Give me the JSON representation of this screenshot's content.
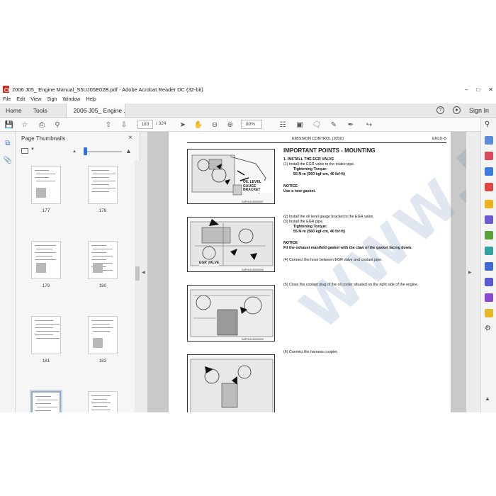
{
  "window": {
    "title": "2006 J05_ Engine Manual_S5UJ05E02B.pdf - Adobe Acrobat Reader DC (32-bit)"
  },
  "menu": [
    "File",
    "Edit",
    "View",
    "Sign",
    "Window",
    "Help"
  ],
  "tabs": {
    "home": "Home",
    "tools": "Tools",
    "document": "2006 J05_ Engine ...",
    "close": "×",
    "sign_in": "Sign In"
  },
  "toolbar": {
    "current_page": "183",
    "total_pages": "/ 324",
    "zoom": "80%"
  },
  "panel": {
    "title": "Page Thumbnails",
    "close": "×",
    "thumbnails": [
      {
        "label": "177"
      },
      {
        "label": "178"
      },
      {
        "label": "179"
      },
      {
        "label": "180"
      },
      {
        "label": "181"
      },
      {
        "label": "182"
      },
      {
        "label": "183",
        "selected": true
      },
      {
        "label": "184"
      },
      {
        "label": ""
      },
      {
        "label": ""
      }
    ]
  },
  "document": {
    "header_title": "EMISSION CONTROL (J05D)",
    "header_page": "EN10–5",
    "section_title": "IMPORTANT POINTS - MOUNTING",
    "step1_heading": "1.    INSTALL THE EGR VALVE",
    "step1_1": "(1)    Install the EGR valve to the intake pipe.",
    "torque_label": "Tightening Torque:",
    "torque_value": "55 N·m {560 kgf·cm, 40 lbf·ft}",
    "notice": "NOTICE",
    "notice1_text": "Use a new gasket.",
    "step1_2": "(2)    Install the oil level gauge bracket to the EGR valve.",
    "step1_3": "(3)    Install the EGR pipe.",
    "torque_label_2": "Tightening Torque:",
    "torque_value_2": "55 N·m {560 kgf·cm, 40 lbf·ft}",
    "notice2": "NOTICE",
    "notice2_text": "Fit the exhaust manifold gasket with the claw of the gasket facing down.",
    "step1_4": "(4)    Connect the hose between EGR valve and coolant pipe.",
    "step1_5": "(5)    Close the coolant plug of the oil cooler situated on the right side of the engine.",
    "step1_6": "(6)    Connect the harness coupler.",
    "fig1_label": "OIL LEVEL GAUGE BRACKET",
    "fig1_caption": "SAPH01103000007",
    "fig2_label": "EGR VALVE",
    "fig2_caption": "SAPH01103000008",
    "fig3_caption": "SAPH01103000009"
  },
  "watermark": "WWW.EPCATEPO.COM"
}
